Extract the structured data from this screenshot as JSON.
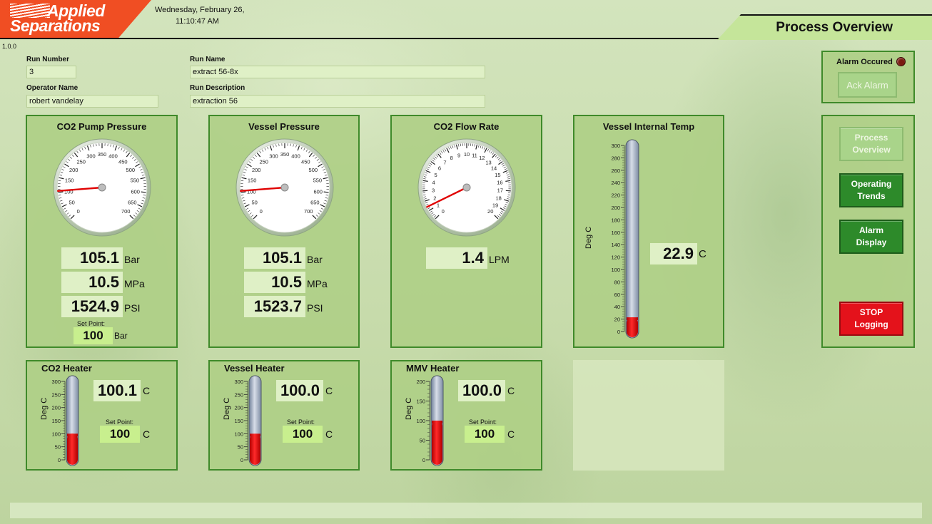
{
  "header": {
    "logo_line1": "Applied",
    "logo_line2": "Separations",
    "date": "Wednesday, February 26,",
    "time": "11:10:47 AM",
    "version": "1.0.0",
    "page_title": "Process Overview"
  },
  "run": {
    "run_number_label": "Run Number",
    "run_number": "3",
    "run_name_label": "Run Name",
    "run_name": "extract 56-8x",
    "operator_label": "Operator Name",
    "operator": "robert vandelay",
    "description_label": "Run Description",
    "description": "extraction 56"
  },
  "alarm": {
    "label": "Alarm Occured",
    "ack_label": "Ack Alarm",
    "indicator_color": "#7a1a10"
  },
  "nav": {
    "process_overview": "Process Overview",
    "operating_trends": "Operating Trends",
    "alarm_display": "Alarm Display",
    "stop_logging": "STOP Logging"
  },
  "pump": {
    "title": "CO2 Pump Pressure",
    "bar": "105.1",
    "bar_unit": "Bar",
    "mpa": "10.5",
    "mpa_unit": "MPa",
    "psi": "1524.9",
    "psi_unit": "PSI",
    "setpoint_label": "Set Point:",
    "setpoint": "100",
    "setpoint_unit": "Bar",
    "gauge_ticks": [
      "0",
      "50",
      "100",
      "150",
      "200",
      "250",
      "300",
      "350",
      "400",
      "450",
      "500",
      "550",
      "600",
      "650",
      "700"
    ],
    "gauge_value": 105.1,
    "gauge_min": 0,
    "gauge_max": 700
  },
  "vessel_pressure": {
    "title": "Vessel Pressure",
    "bar": "105.1",
    "bar_unit": "Bar",
    "mpa": "10.5",
    "mpa_unit": "MPa",
    "psi": "1523.7",
    "psi_unit": "PSI",
    "gauge_ticks": [
      "0",
      "50",
      "100",
      "150",
      "200",
      "250",
      "300",
      "350",
      "400",
      "450",
      "500",
      "550",
      "600",
      "650",
      "700"
    ],
    "gauge_value": 105.1,
    "gauge_min": 0,
    "gauge_max": 700
  },
  "flow": {
    "title": "CO2 Flow Rate",
    "value": "1.4",
    "unit": "LPM",
    "gauge_ticks": [
      "0",
      "1",
      "2",
      "3",
      "4",
      "5",
      "6",
      "7",
      "8",
      "9",
      "10",
      "11",
      "12",
      "13",
      "14",
      "15",
      "16",
      "17",
      "18",
      "19",
      "20"
    ],
    "gauge_value": 1.4,
    "gauge_min": 0,
    "gauge_max": 20
  },
  "vessel_temp": {
    "title": "Vessel Internal Temp",
    "axis_title": "Deg C",
    "value": "22.9",
    "unit": "C",
    "ticks": [
      "0",
      "20",
      "40",
      "60",
      "80",
      "100",
      "120",
      "140",
      "160",
      "180",
      "200",
      "220",
      "240",
      "260",
      "280",
      "300"
    ],
    "level": 22.9,
    "min": 0,
    "max": 300
  },
  "co2_heater": {
    "title": "CO2 Heater",
    "axis_title": "Deg C",
    "value": "100.1",
    "unit": "C",
    "setpoint_label": "Set Point:",
    "setpoint": "100",
    "setpoint_unit": "C",
    "ticks": [
      "0",
      "50",
      "100",
      "150",
      "200",
      "250",
      "300"
    ],
    "level": 100.1,
    "min": 0,
    "max": 300
  },
  "vessel_heater": {
    "title": "Vessel Heater",
    "axis_title": "Deg C",
    "value": "100.0",
    "unit": "C",
    "setpoint_label": "Set Point:",
    "setpoint": "100",
    "setpoint_unit": "C",
    "ticks": [
      "0",
      "50",
      "100",
      "150",
      "200",
      "250",
      "300"
    ],
    "level": 100.0,
    "min": 0,
    "max": 300
  },
  "mmv_heater": {
    "title": "MMV Heater",
    "axis_title": "Deg C",
    "value": "100.0",
    "unit": "C",
    "setpoint_label": "Set Point:",
    "setpoint": "100",
    "setpoint_unit": "C",
    "ticks": [
      "0",
      "50",
      "100",
      "150",
      "200"
    ],
    "level": 100.0,
    "min": 0,
    "max": 200
  },
  "colors": {
    "panel_border": "#3f8a2a",
    "mercury": "#e00000",
    "needle": "#e00000",
    "nav_green": "#2d8a2a",
    "stop_red": "#e4121b",
    "logo_orange": "#f04e23"
  }
}
